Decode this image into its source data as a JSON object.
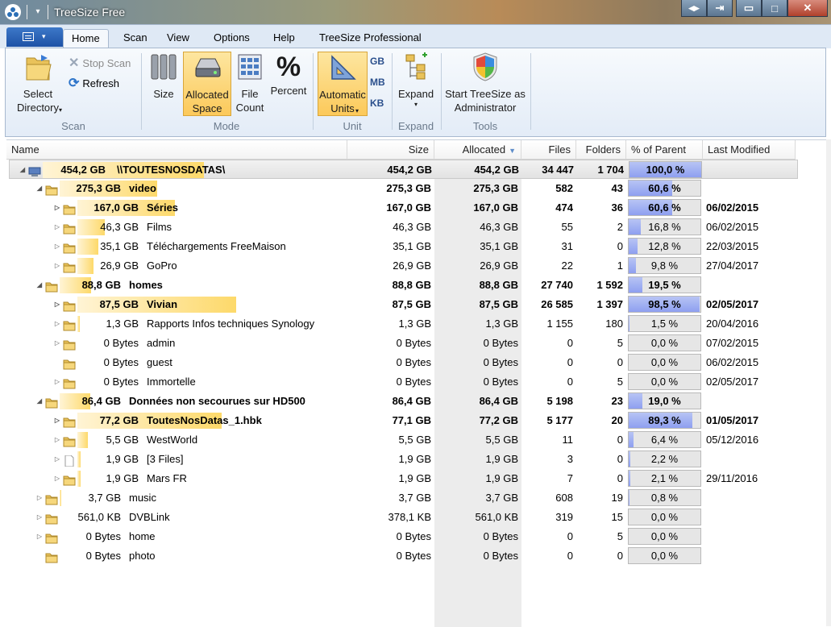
{
  "window": {
    "title": "TreeSize Free",
    "buttons": {
      "restore": "◂▸",
      "export": "⇥",
      "minimize": "▭",
      "maximize": "□",
      "close": "✕"
    }
  },
  "ribbon": {
    "tabs": [
      "Home",
      "Scan",
      "View",
      "Options",
      "Help",
      "TreeSize Professional"
    ],
    "active_tab": "Home",
    "scan_group": {
      "select_directory": "Select\nDirectory",
      "stop_scan": "Stop Scan",
      "refresh": "Refresh",
      "label": "Scan"
    },
    "mode_group": {
      "size": "Size",
      "allocated_space": "Allocated\nSpace",
      "file_count": "File\nCount",
      "percent": "Percent",
      "label": "Mode"
    },
    "unit_group": {
      "automatic_units": "Automatic\nUnits",
      "gb": "GB",
      "mb": "MB",
      "kb": "KB",
      "label": "Unit"
    },
    "expand_group": {
      "expand": "Expand",
      "label": "Expand"
    },
    "tools_group": {
      "start_admin": "Start TreeSize as\nAdministrator",
      "label": "Tools"
    }
  },
  "columns": {
    "name": "Name",
    "size": "Size",
    "allocated": "Allocated",
    "files": "Files",
    "folders": "Folders",
    "pct_parent": "% of Parent ...",
    "last_modified": "Last Modified"
  },
  "rows": [
    {
      "level": 0,
      "expander": "open",
      "icon": "drive",
      "barsize": "454,2 GB",
      "name": "\\\\TOUTESNOSDATAS\\",
      "size": "454,2 GB",
      "allocated": "454,2 GB",
      "files": "34 447",
      "folders": "1 704",
      "pct": "100,0 %",
      "pct_value": 100.0,
      "bar": 1.0,
      "last_modified": "",
      "bold": true,
      "root": true
    },
    {
      "level": 1,
      "expander": "open",
      "icon": "folder",
      "barsize": "275,3 GB",
      "name": "video",
      "size": "275,3 GB",
      "allocated": "275,3 GB",
      "files": "582",
      "folders": "43",
      "pct": "60,6 %",
      "pct_value": 60.6,
      "bar": 0.606,
      "last_modified": "",
      "bold": true
    },
    {
      "level": 2,
      "expander": "closed",
      "icon": "folder",
      "barsize": "167,0 GB",
      "name": "Séries",
      "size": "167,0 GB",
      "allocated": "167,0 GB",
      "files": "474",
      "folders": "36",
      "pct": "60,6 %",
      "pct_value": 60.6,
      "bar": 0.606,
      "last_modified": "06/02/2015",
      "bold": true
    },
    {
      "level": 2,
      "expander": "closed",
      "icon": "folder",
      "barsize": "46,3 GB",
      "name": "Films",
      "size": "46,3 GB",
      "allocated": "46,3 GB",
      "files": "55",
      "folders": "2",
      "pct": "16,8 %",
      "pct_value": 16.8,
      "bar": 0.168,
      "last_modified": "06/02/2015",
      "bold": false
    },
    {
      "level": 2,
      "expander": "closed",
      "icon": "folder",
      "barsize": "35,1 GB",
      "name": "Téléchargements FreeMaison",
      "size": "35,1 GB",
      "allocated": "35,1 GB",
      "files": "31",
      "folders": "0",
      "pct": "12,8 %",
      "pct_value": 12.8,
      "bar": 0.128,
      "last_modified": "22/03/2015",
      "bold": false
    },
    {
      "level": 2,
      "expander": "closed",
      "icon": "folder",
      "barsize": "26,9 GB",
      "name": "GoPro",
      "size": "26,9 GB",
      "allocated": "26,9 GB",
      "files": "22",
      "folders": "1",
      "pct": "9,8 %",
      "pct_value": 9.8,
      "bar": 0.098,
      "last_modified": "27/04/2017",
      "bold": false
    },
    {
      "level": 1,
      "expander": "open",
      "icon": "folder",
      "barsize": "88,8 GB",
      "name": "homes",
      "size": "88,8 GB",
      "allocated": "88,8 GB",
      "files": "27 740",
      "folders": "1 592",
      "pct": "19,5 %",
      "pct_value": 19.5,
      "bar": 0.195,
      "last_modified": "",
      "bold": true
    },
    {
      "level": 2,
      "expander": "closed",
      "icon": "folder",
      "barsize": "87,5 GB",
      "name": "Vivian",
      "size": "87,5 GB",
      "allocated": "87,5 GB",
      "files": "26 585",
      "folders": "1 397",
      "pct": "98,5 %",
      "pct_value": 98.5,
      "bar": 0.985,
      "last_modified": "02/05/2017",
      "bold": true
    },
    {
      "level": 2,
      "expander": "closed",
      "icon": "folder",
      "barsize": "1,3 GB",
      "name": "Rapports Infos techniques Synology",
      "size": "1,3 GB",
      "allocated": "1,3 GB",
      "files": "1 155",
      "folders": "180",
      "pct": "1,5 %",
      "pct_value": 1.5,
      "bar": 0.015,
      "last_modified": "20/04/2016",
      "bold": false
    },
    {
      "level": 2,
      "expander": "closed",
      "icon": "folder",
      "barsize": "0 Bytes",
      "name": "admin",
      "size": "0 Bytes",
      "allocated": "0 Bytes",
      "files": "0",
      "folders": "5",
      "pct": "0,0 %",
      "pct_value": 0.0,
      "bar": 0.0,
      "last_modified": "07/02/2015",
      "bold": false
    },
    {
      "level": 2,
      "expander": "none",
      "icon": "folder",
      "barsize": "0 Bytes",
      "name": "guest",
      "size": "0 Bytes",
      "allocated": "0 Bytes",
      "files": "0",
      "folders": "0",
      "pct": "0,0 %",
      "pct_value": 0.0,
      "bar": 0.0,
      "last_modified": "06/02/2015",
      "bold": false
    },
    {
      "level": 2,
      "expander": "closed",
      "icon": "folder",
      "barsize": "0 Bytes",
      "name": "Immortelle",
      "size": "0 Bytes",
      "allocated": "0 Bytes",
      "files": "0",
      "folders": "5",
      "pct": "0,0 %",
      "pct_value": 0.0,
      "bar": 0.0,
      "last_modified": "02/05/2017",
      "bold": false
    },
    {
      "level": 1,
      "expander": "open",
      "icon": "folder",
      "barsize": "86,4 GB",
      "name": "Données non secourues sur HD500",
      "size": "86,4 GB",
      "allocated": "86,4 GB",
      "files": "5 198",
      "folders": "23",
      "pct": "19,0 %",
      "pct_value": 19.0,
      "bar": 0.19,
      "last_modified": "",
      "bold": true
    },
    {
      "level": 2,
      "expander": "closed",
      "icon": "folder",
      "barsize": "77,2 GB",
      "name": "ToutesNosDatas_1.hbk",
      "size": "77,1 GB",
      "allocated": "77,2 GB",
      "files": "5 177",
      "folders": "20",
      "pct": "89,3 %",
      "pct_value": 89.3,
      "bar": 0.893,
      "last_modified": "01/05/2017",
      "bold": true
    },
    {
      "level": 2,
      "expander": "closed",
      "icon": "folder",
      "barsize": "5,5 GB",
      "name": "WestWorld",
      "size": "5,5 GB",
      "allocated": "5,5 GB",
      "files": "11",
      "folders": "0",
      "pct": "6,4 %",
      "pct_value": 6.4,
      "bar": 0.064,
      "last_modified": "05/12/2016",
      "bold": false
    },
    {
      "level": 2,
      "expander": "closed",
      "icon": "file",
      "barsize": "1,9 GB",
      "name": "[3 Files]",
      "size": "1,9 GB",
      "allocated": "1,9 GB",
      "files": "3",
      "folders": "0",
      "pct": "2,2 %",
      "pct_value": 2.2,
      "bar": 0.022,
      "last_modified": "",
      "bold": false
    },
    {
      "level": 2,
      "expander": "closed",
      "icon": "folder",
      "barsize": "1,9 GB",
      "name": "Mars FR",
      "size": "1,9 GB",
      "allocated": "1,9 GB",
      "files": "7",
      "folders": "0",
      "pct": "2,1 %",
      "pct_value": 2.1,
      "bar": 0.021,
      "last_modified": "29/11/2016",
      "bold": false
    },
    {
      "level": 1,
      "expander": "closed",
      "icon": "folder",
      "barsize": "3,7 GB",
      "name": "music",
      "size": "3,7 GB",
      "allocated": "3,7 GB",
      "files": "608",
      "folders": "19",
      "pct": "0,8 %",
      "pct_value": 0.8,
      "bar": 0.008,
      "last_modified": "",
      "bold": false
    },
    {
      "level": 1,
      "expander": "closed",
      "icon": "folder",
      "barsize": "561,0 KB",
      "name": "DVBLink",
      "size": "378,1 KB",
      "allocated": "561,0 KB",
      "files": "319",
      "folders": "15",
      "pct": "0,0 %",
      "pct_value": 0.0,
      "bar": 0.0,
      "last_modified": "",
      "bold": false
    },
    {
      "level": 1,
      "expander": "closed",
      "icon": "folder",
      "barsize": "0 Bytes",
      "name": "home",
      "size": "0 Bytes",
      "allocated": "0 Bytes",
      "files": "0",
      "folders": "5",
      "pct": "0,0 %",
      "pct_value": 0.0,
      "bar": 0.0,
      "last_modified": "",
      "bold": false
    },
    {
      "level": 1,
      "expander": "none",
      "icon": "folder",
      "barsize": "0 Bytes",
      "name": "photo",
      "size": "0 Bytes",
      "allocated": "0 Bytes",
      "files": "0",
      "folders": "0",
      "pct": "0,0 %",
      "pct_value": 0.0,
      "bar": 0.0,
      "last_modified": "",
      "bold": false
    }
  ],
  "colors": {
    "size_bar": "#fdd96a",
    "pct_bar": "#8e9ff0",
    "selected_button": "#fcc95a",
    "ribbon_bg": "#dfe9f5"
  }
}
